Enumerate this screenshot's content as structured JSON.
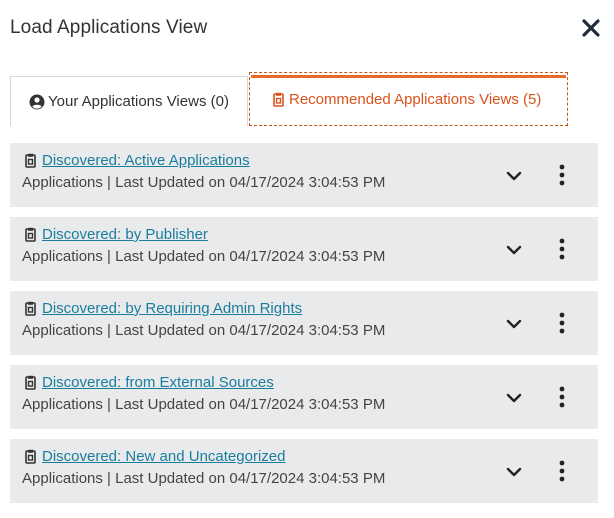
{
  "dialog": {
    "title": "Load Applications View",
    "close_icon": "close-icon"
  },
  "tabs": [
    {
      "label": "Your Applications Views (0)",
      "icon": "user-circle-icon",
      "active": false
    },
    {
      "label": "Recommended Applications Views (5)",
      "icon": "clipboard-icon",
      "active": true
    }
  ],
  "colors": {
    "accent": "#e8692a",
    "accent_text": "#d9531e",
    "link": "#1a7d9e",
    "card_bg": "#e9eaec"
  },
  "views": [
    {
      "name": "Discovered: Active Applications",
      "meta": "Applications | Last Updated on 04/17/2024 3:04:53 PM"
    },
    {
      "name": "Discovered: by Publisher",
      "meta": "Applications | Last Updated on 04/17/2024 3:04:53 PM"
    },
    {
      "name": "Discovered: by Requiring Admin Rights",
      "meta": "Applications | Last Updated on 04/17/2024 3:04:53 PM"
    },
    {
      "name": "Discovered: from External Sources",
      "meta": "Applications | Last Updated on 04/17/2024 3:04:53 PM"
    },
    {
      "name": "Discovered: New and Uncategorized",
      "meta": "Applications | Last Updated on 04/17/2024 3:04:53 PM"
    }
  ]
}
